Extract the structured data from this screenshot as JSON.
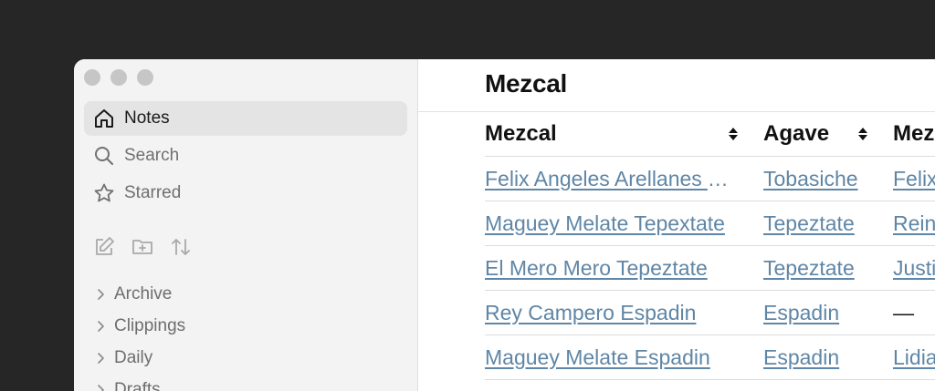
{
  "sidebar": {
    "nav": [
      {
        "label": "Notes",
        "icon": "home-icon",
        "active": true
      },
      {
        "label": "Search",
        "icon": "search-icon"
      },
      {
        "label": "Starred",
        "icon": "star-icon"
      }
    ],
    "toolbar_icons": [
      "new-note-icon",
      "new-folder-icon",
      "sort-icon"
    ],
    "folders": [
      "Archive",
      "Clippings",
      "Daily",
      "Drafts"
    ]
  },
  "main": {
    "title": "Mezcal",
    "table": {
      "columns": [
        "Mezcal",
        "Agave",
        "Mezcalero"
      ],
      "rows": [
        [
          "Felix Angeles Arellanes Tobasiche",
          "Tobasiche",
          "Felix Angeles Arellanes"
        ],
        [
          "Maguey Melate Tepextate",
          "Tepeztate",
          "Reina"
        ],
        [
          "El Mero Mero Tepeztate",
          "Tepeztate",
          "Justino"
        ],
        [
          "Rey Campero Espadin",
          "Espadin",
          "—"
        ],
        [
          "Maguey Melate Espadin",
          "Espadin",
          "Lidia"
        ]
      ],
      "row_links": [
        [
          true,
          true,
          true
        ],
        [
          true,
          true,
          true
        ],
        [
          true,
          true,
          true
        ],
        [
          true,
          true,
          false
        ],
        [
          true,
          true,
          true
        ]
      ]
    }
  },
  "colors": {
    "link": "#5f86a6",
    "background": "#262626",
    "sidebar": "#f3f3f3"
  }
}
